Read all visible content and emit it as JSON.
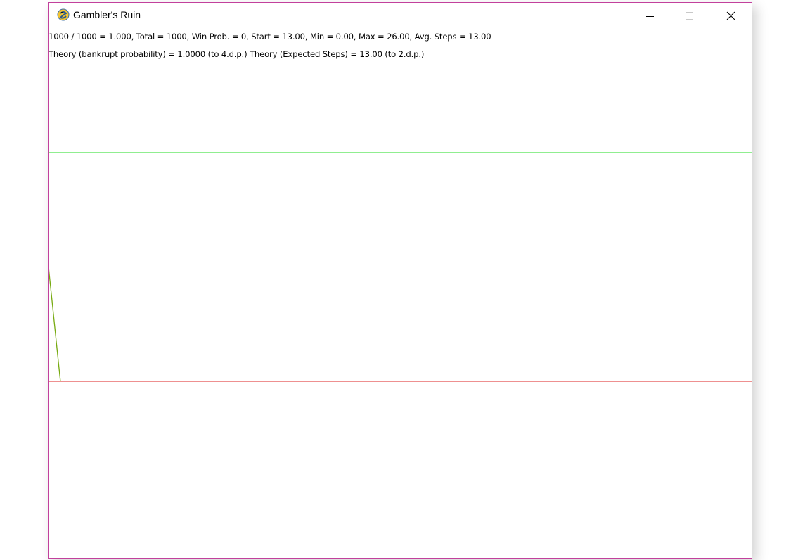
{
  "window": {
    "title": "Gambler's Ruin",
    "icon": "pygame-snake-icon",
    "border_color": "#c2409c",
    "controls": {
      "minimize_icon": "minimize-icon",
      "maximize_icon": "maximize-icon",
      "close_icon": "close-icon"
    }
  },
  "stats": {
    "line1": "1000 / 1000 = 1.000, Total = 1000, Win Prob. = 0, Start = 13.00, Min = 0.00, Max = 26.00, Avg. Steps = 13.00",
    "line2": "Theory (bankrupt probability) = 1.0000 (to 4.d.p.)  Theory (Expected Steps) = 13.00 (to 2.d.p.)"
  },
  "simulation": {
    "start": 13,
    "min": 0,
    "max": 26,
    "avg_steps": 13,
    "colors": {
      "max_line": "#22dd22",
      "min_line": "#dd2222",
      "path": "#77aa11"
    }
  }
}
